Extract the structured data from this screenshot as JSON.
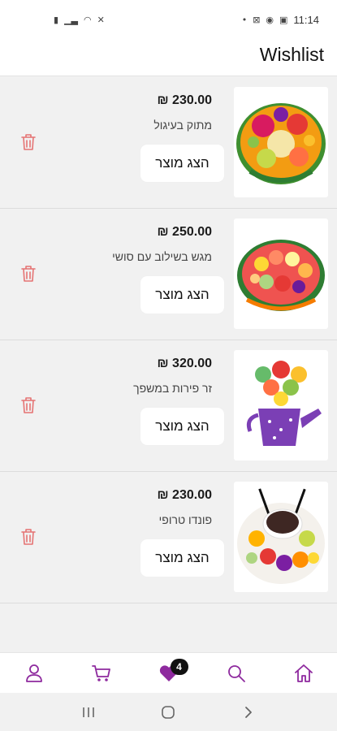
{
  "status_bar": {
    "time": "11:14"
  },
  "header": {
    "title": "Wishlist"
  },
  "colors": {
    "accent": "#8e2a9e",
    "trash": "#e57373",
    "bg": "#f1f1f1"
  },
  "wishlist": {
    "items": [
      {
        "price": "₪ 230.00",
        "name": "מתוק בעיגול",
        "button_label": "הצג מוצר",
        "image_icon": "fruit-platter-image"
      },
      {
        "price": "₪ 250.00",
        "name": "מגש בשילוב עם סושי",
        "button_label": "הצג מוצר",
        "image_icon": "fruit-sushi-tray-image"
      },
      {
        "price": "₪ 320.00",
        "name": "זר פירות במשפך",
        "button_label": "הצג מוצר",
        "image_icon": "fruit-bouquet-watering-can-image"
      },
      {
        "price": "₪ 230.00",
        "name": "פונדו טרופי",
        "button_label": "הצג מוצר",
        "image_icon": "tropical-fondue-image"
      }
    ]
  },
  "bottom_nav": {
    "wishlist_badge": "4",
    "items": [
      "user-icon",
      "cart-icon",
      "heart-icon",
      "search-icon",
      "home-icon"
    ]
  }
}
